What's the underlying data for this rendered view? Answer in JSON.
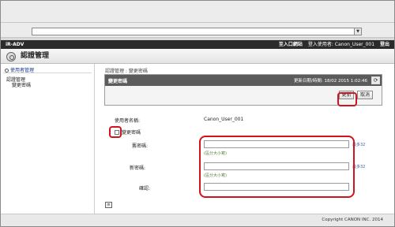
{
  "browser": {
    "dropdown_arrow": "▼"
  },
  "header": {
    "product": "iR-ADV",
    "portal_link": "至入口網站",
    "login_user": "登入使用者: Canon_User_001",
    "logout_link": "登出"
  },
  "page": {
    "title": "認證管理",
    "title_icon": "gear-icon"
  },
  "sidebar": {
    "user_mgmt": "使用者管理",
    "auth_mgmt": "認證管理",
    "change_password": "變更密碼"
  },
  "main": {
    "breadcrumb": "認證管理 : 變更密碼",
    "panel_title": "變更密碼",
    "last_updated": "更新日期/時間: 18/02 2015 1:02:46",
    "refresh_icon": "refresh-icon",
    "update_button": "更新",
    "cancel_button": "取消"
  },
  "form": {
    "username_label": "使用者名稱:",
    "username_value": "Canon_User_001",
    "change_pw_label": "變更密碼",
    "old_pw_label": "舊密碼:",
    "old_pw_max": "最多32",
    "old_pw_hint": "(區分大小寫)",
    "new_pw_label": "新密碼:",
    "new_pw_max": "最多32",
    "new_pw_hint": "(區分大小寫)",
    "confirm_label": "確認:",
    "top_icon_label": "頁首"
  },
  "footer": {
    "copyright": "Copyright CANON INC. 2014"
  },
  "colors": {
    "highlight": "#d0141c",
    "header_bg": "#2b2b2b",
    "panel_head_bg": "#5b5b5b"
  }
}
